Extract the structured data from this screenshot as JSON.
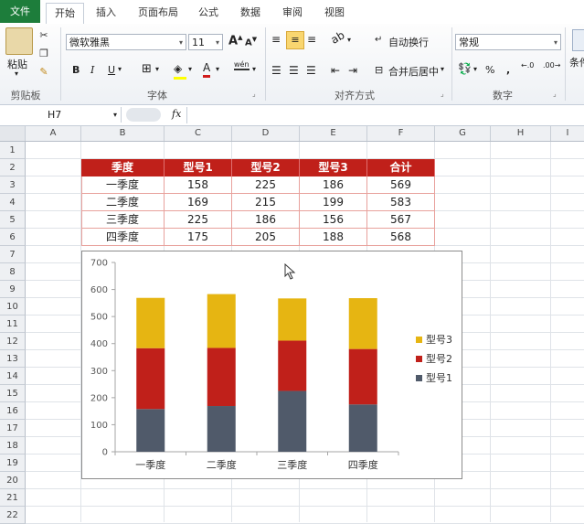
{
  "ribbon": {
    "tabs": [
      "文件",
      "开始",
      "插入",
      "页面布局",
      "公式",
      "数据",
      "审阅",
      "视图"
    ],
    "active_tab": "开始",
    "clipboard": {
      "paste_label": "粘贴",
      "group_label": "剪贴板"
    },
    "font": {
      "name": "微软雅黑",
      "size": "11",
      "group_label": "字体",
      "bold": "B",
      "italic": "I",
      "underline": "U",
      "grow": "A",
      "shrink": "A",
      "color_letter": "A",
      "phonetic": "wén"
    },
    "alignment": {
      "wrap_label": "自动换行",
      "merge_label": "合并后居中",
      "group_label": "对齐方式"
    },
    "number": {
      "format": "常规",
      "group_label": "数字",
      "percent": "%",
      "comma": ",",
      "inc_decimal": "←.0",
      "dec_decimal": ".00→"
    },
    "styles": {
      "cond_label": "条件"
    }
  },
  "formula_bar": {
    "name_box": "H7",
    "fx": "fx",
    "formula": ""
  },
  "columns": [
    "A",
    "B",
    "C",
    "D",
    "E",
    "F",
    "G",
    "H",
    "I"
  ],
  "rows": [
    "1",
    "2",
    "3",
    "4",
    "5",
    "6",
    "7",
    "8",
    "9",
    "10",
    "11",
    "12",
    "13",
    "14",
    "15",
    "16",
    "17",
    "18",
    "19",
    "20",
    "21",
    "22"
  ],
  "table": {
    "headers": [
      "季度",
      "型号1",
      "型号2",
      "型号3",
      "合计"
    ],
    "rows": [
      [
        "一季度",
        "158",
        "225",
        "186",
        "569"
      ],
      [
        "二季度",
        "169",
        "215",
        "199",
        "583"
      ],
      [
        "三季度",
        "225",
        "186",
        "156",
        "567"
      ],
      [
        "四季度",
        "175",
        "205",
        "188",
        "568"
      ]
    ]
  },
  "colors": {
    "series1": "#505a6a",
    "series2": "#c0201a",
    "series3": "#e6b512",
    "header": "#c0201a",
    "file_tab": "#1d7d3b"
  },
  "chart_data": {
    "type": "bar",
    "stacked": true,
    "categories": [
      "一季度",
      "二季度",
      "三季度",
      "四季度"
    ],
    "series": [
      {
        "name": "型号1",
        "values": [
          158,
          169,
          225,
          175
        ],
        "color": "#505a6a"
      },
      {
        "name": "型号2",
        "values": [
          225,
          215,
          186,
          205
        ],
        "color": "#c0201a"
      },
      {
        "name": "型号3",
        "values": [
          186,
          199,
          156,
          188
        ],
        "color": "#e6b512"
      }
    ],
    "ylim": [
      0,
      700
    ],
    "yticks": [
      "0",
      "100",
      "200",
      "300",
      "400",
      "500",
      "600",
      "700"
    ],
    "legend": "right",
    "grid": false
  }
}
